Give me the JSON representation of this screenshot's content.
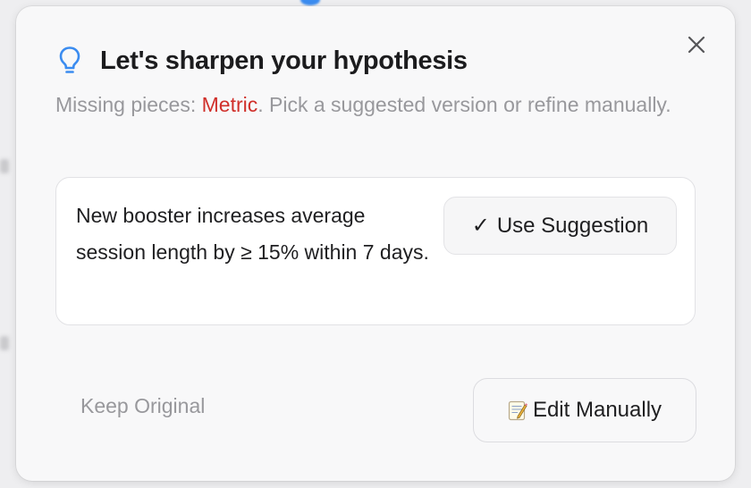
{
  "dialog": {
    "title": "Let's sharpen your hypothesis",
    "title_icon": "lightbulb-icon",
    "close_icon": "close-icon",
    "subtitle_prefix": "Missing pieces: ",
    "missing_piece": "Metric",
    "subtitle_suffix": ". Pick a suggested version or refine manually.",
    "accent_color": "#3b8cf0",
    "missing_color": "#d0302b"
  },
  "suggestion": {
    "text": "New booster increases average session length by ≥ 15% within 7 days.",
    "use_button_check": "✓",
    "use_button_label": "Use Suggestion"
  },
  "actions": {
    "keep_original_label": "Keep Original",
    "edit_manually_icon": "memo-icon",
    "edit_manually_label": "Edit Manually"
  }
}
